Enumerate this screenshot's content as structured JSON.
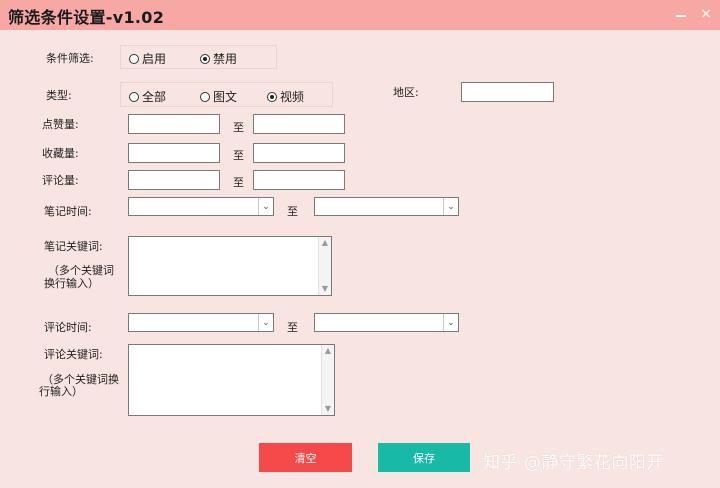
{
  "window": {
    "title": "筛选条件设置-v1.02",
    "minimize_icon": "minimize-icon",
    "close_icon": "close-icon",
    "close_glyph": "×"
  },
  "condition_filter": {
    "label": "条件筛选:",
    "options": [
      {
        "label": "启用",
        "selected": false
      },
      {
        "label": "禁用",
        "selected": true
      }
    ]
  },
  "type": {
    "label": "类型:",
    "options": [
      {
        "label": "全部",
        "selected": false
      },
      {
        "label": "图文",
        "selected": false
      },
      {
        "label": "视频",
        "selected": true
      }
    ]
  },
  "region": {
    "label": "地区:",
    "value": ""
  },
  "likes": {
    "label": "点赞量:",
    "from": "",
    "to_label": "至",
    "to": ""
  },
  "favorites": {
    "label": "收藏量:",
    "from": "",
    "to_label": "至",
    "to": ""
  },
  "comments": {
    "label": "评论量:",
    "from": "",
    "to_label": "至",
    "to": ""
  },
  "note_time": {
    "label": "笔记时间:",
    "from": "",
    "to_label": "至",
    "to": ""
  },
  "note_keywords": {
    "label": "笔记关键词:",
    "hint_line1": "（多个关键词",
    "hint_line2": "换行输入）",
    "value": ""
  },
  "comment_time": {
    "label": "评论时间:",
    "from": "",
    "to_label": "至",
    "to": ""
  },
  "comment_keywords": {
    "label": "评论关键词:",
    "hint_line1": "（多个关键词换",
    "hint_line2": "行输入）",
    "value": ""
  },
  "buttons": {
    "clear": "清空",
    "save": "保存"
  },
  "watermark": "知乎 @静守繁花向阳开",
  "colors": {
    "background": "#f8e4e1",
    "titlebar": "#f7a8a4",
    "clear_button": "#f44a4a",
    "save_button": "#18b9a5"
  }
}
